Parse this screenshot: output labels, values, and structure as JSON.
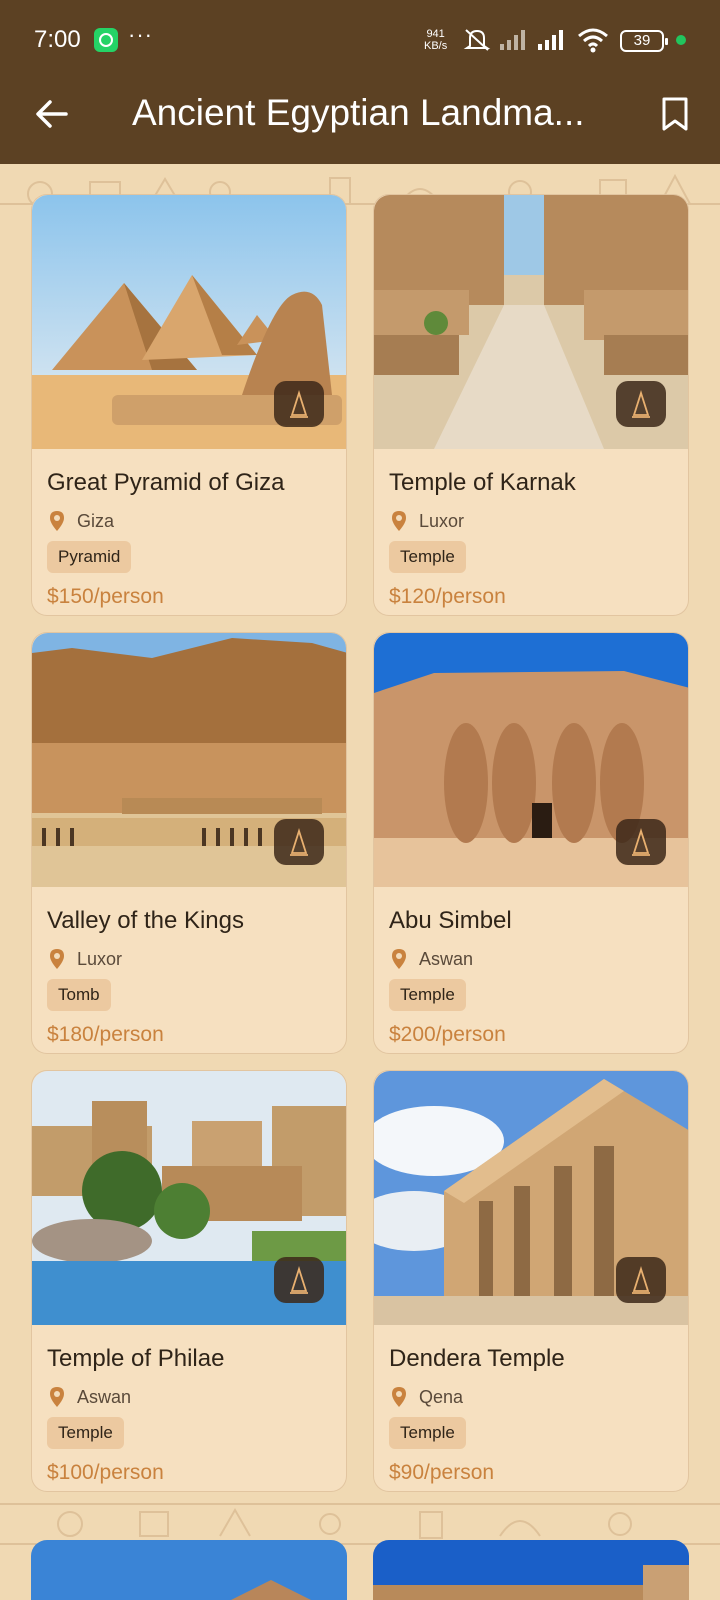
{
  "status_bar": {
    "time": "7:00",
    "more": "···",
    "net_speed_value": "941",
    "net_speed_unit": "KB/s",
    "battery": "39",
    "colors": {
      "dot": "#22c55e",
      "whatsapp": "#25d366"
    }
  },
  "app_bar": {
    "title": "Ancient Egyptian Landma...",
    "back_icon": "arrow-left-icon",
    "bookmark_icon": "bookmark-icon"
  },
  "theme": {
    "header_bg": "#5c4123",
    "page_bg": "#f0d9b3",
    "price_color": "#c9823e",
    "pin_color": "#c9823e",
    "tag_bg": "#ecc9a0"
  },
  "cards": [
    {
      "name": "Great Pyramid of Giza",
      "location": "Giza",
      "tag": "Pyramid",
      "price": "$150/person",
      "image": "pyramids-sphinx"
    },
    {
      "name": "Temple of Karnak",
      "location": "Luxor",
      "tag": "Temple",
      "price": "$120/person",
      "image": "karnak-avenue-of-sphinxes"
    },
    {
      "name": "Valley of the Kings",
      "location": "Luxor",
      "tag": "Tomb",
      "price": "$180/person",
      "image": "hatshepsut-temple-cliffs"
    },
    {
      "name": "Abu Simbel",
      "location": "Aswan",
      "tag": "Temple",
      "price": "$200/person",
      "image": "abu-simbel-colossi"
    },
    {
      "name": "Temple of Philae",
      "location": "Aswan",
      "tag": "Temple",
      "price": "$100/person",
      "image": "philae-temple-river"
    },
    {
      "name": "Dendera Temple",
      "location": "Qena",
      "tag": "Temple",
      "price": "$90/person",
      "image": "dendera-temple-columns"
    }
  ]
}
